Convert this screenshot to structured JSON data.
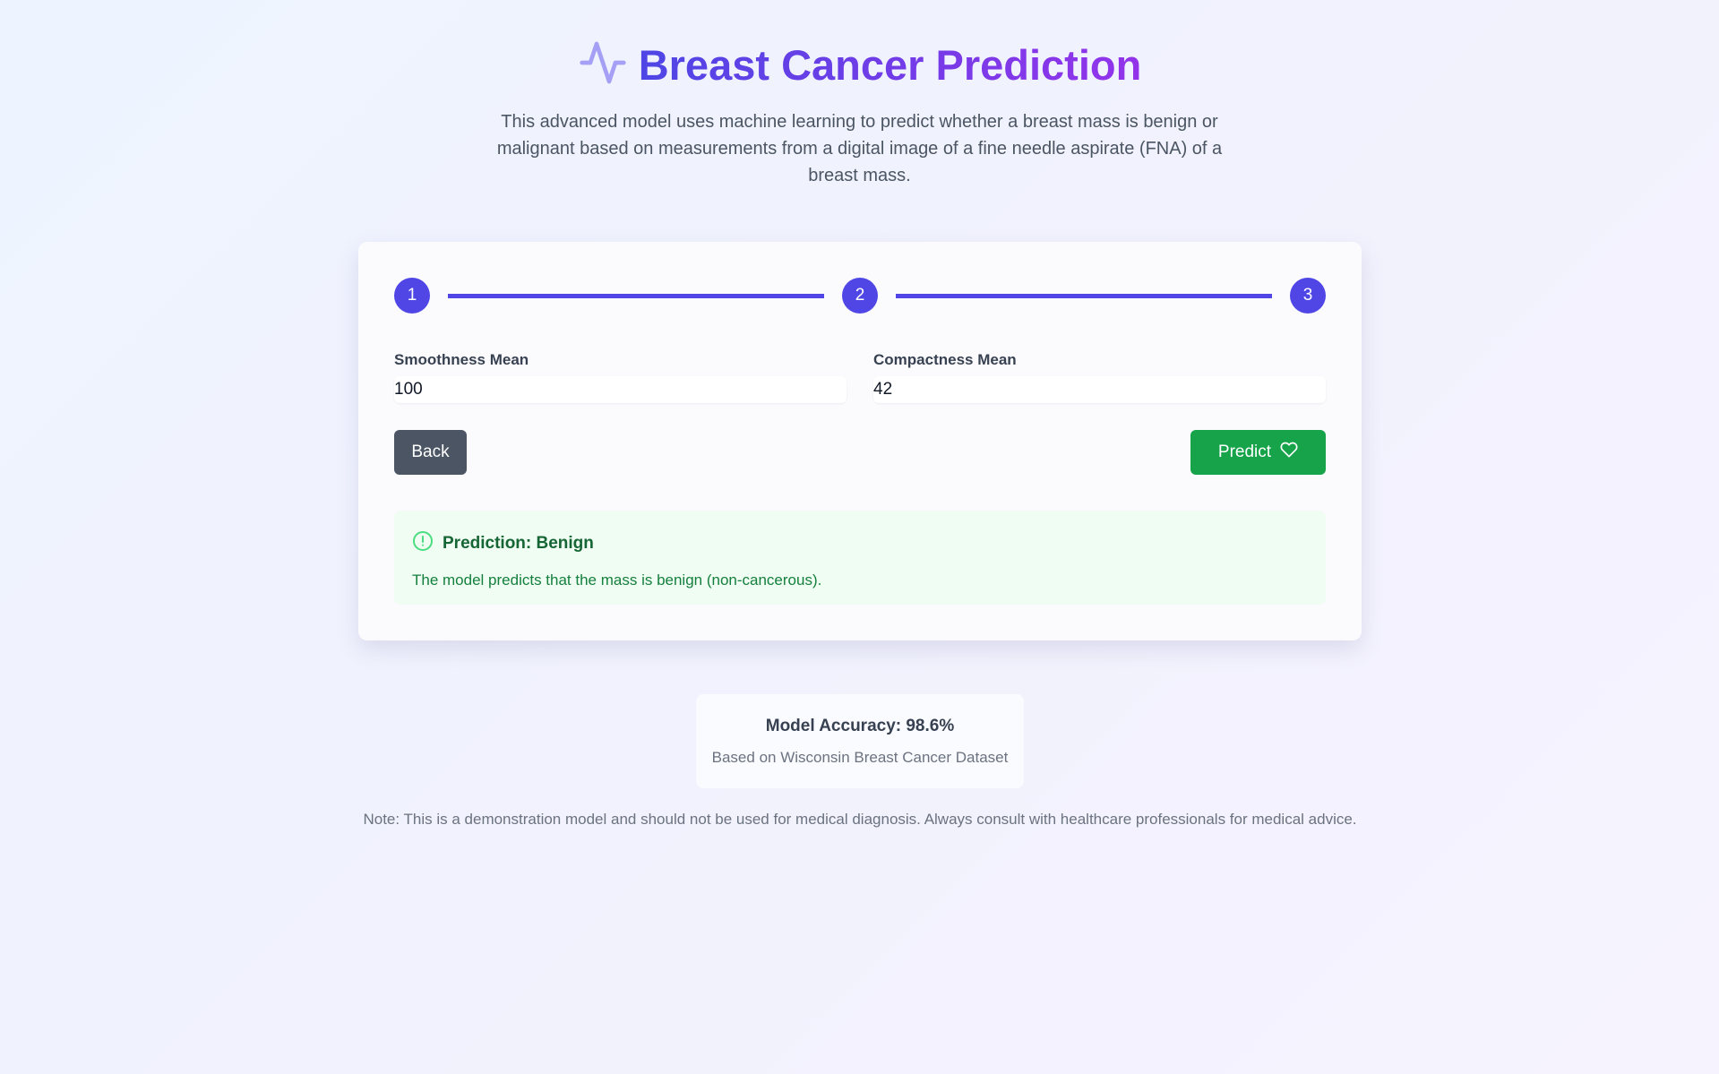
{
  "header": {
    "icon": "activity-icon",
    "title": "Breast Cancer Prediction",
    "description": "This advanced model uses machine learning to predict whether a breast mass is benign or malignant based on measurements from a digital image of a fine needle aspirate (FNA) of a breast mass."
  },
  "steps": [
    "1",
    "2",
    "3"
  ],
  "current_step": 3,
  "form": {
    "fields": [
      {
        "label": "Smoothness Mean",
        "value": "100"
      },
      {
        "label": "Compactness Mean",
        "value": "42"
      }
    ],
    "back_label": "Back",
    "predict_label": "Predict"
  },
  "result": {
    "title": "Prediction: Benign",
    "text": "The model predicts that the mass is benign (non-cancerous)."
  },
  "accuracy": {
    "title": "Model Accuracy: 98.6%",
    "subtitle": "Based on Wisconsin Breast Cancer Dataset"
  },
  "note": "Note: This is a demonstration model and should not be used for medical diagnosis. Always consult with healthcare professionals for medical advice.",
  "colors": {
    "primary": "#4f46e5",
    "success": "#16a34a",
    "secondary": "#4b5563"
  }
}
